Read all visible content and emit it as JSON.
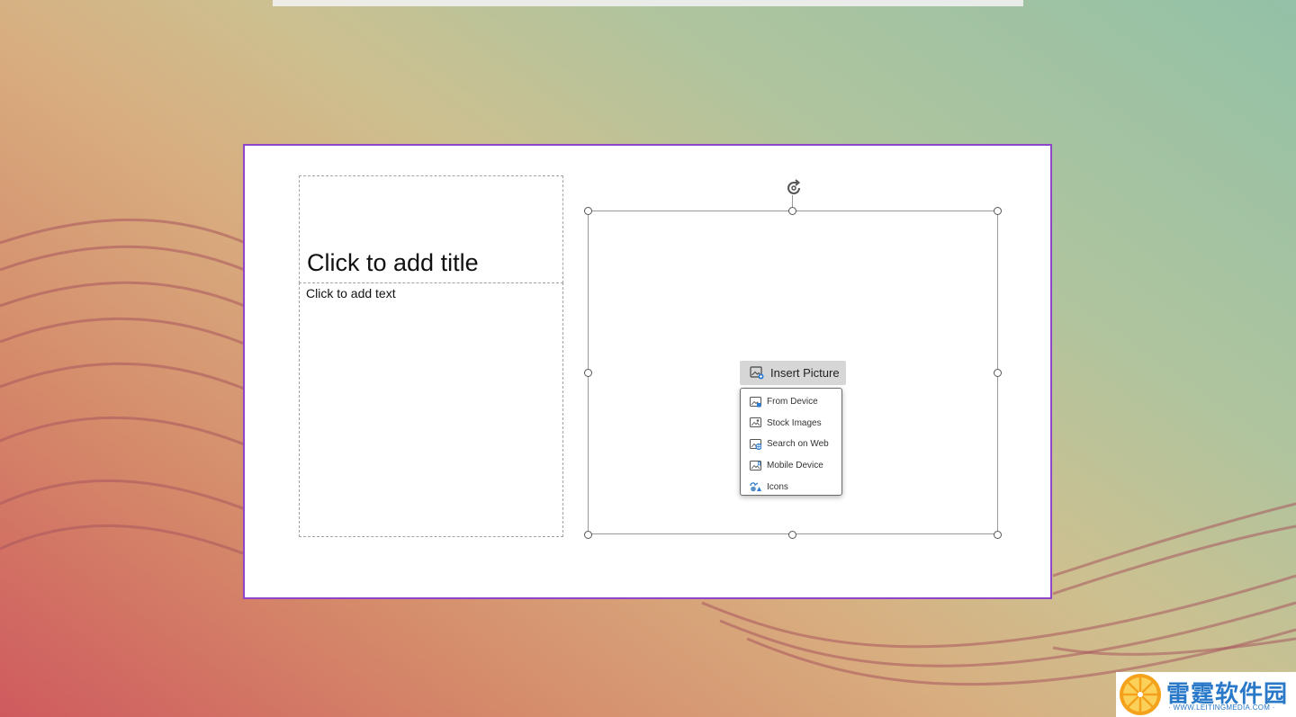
{
  "slide": {
    "title_placeholder": "Click to add title",
    "text_placeholder": "Click to add text"
  },
  "insert_picture": {
    "button_label": "Insert Picture",
    "menu": [
      {
        "label": "From Device",
        "icon": "picture-device-icon"
      },
      {
        "label": "Stock Images",
        "icon": "stock-images-icon"
      },
      {
        "label": "Search on Web",
        "icon": "picture-web-icon"
      },
      {
        "label": "Mobile Device",
        "icon": "picture-mobile-icon"
      },
      {
        "label": "Icons",
        "icon": "icons-shapes-icon"
      }
    ]
  },
  "watermark": {
    "name": "雷霆软件园",
    "url": "· WWW.LEITINGMEDIA.COM ·"
  },
  "colors": {
    "slide_selection_border": "#8f45c9",
    "menu_icon_accent": "#2b7cd3"
  }
}
